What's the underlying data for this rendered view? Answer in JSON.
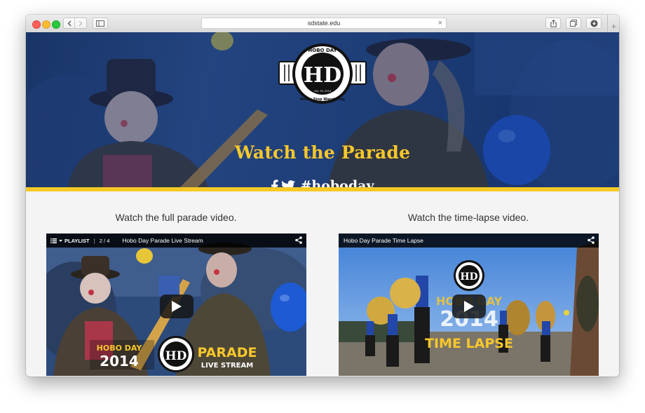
{
  "browser": {
    "url": "sdstate.edu"
  },
  "hero": {
    "logo_text_top": "HOBO DAY",
    "logo_monogram": "HD",
    "logo_date": "Oct. 25, 2014",
    "logo_text_bottom": "Never Stop Wandering",
    "title": "Watch the Parade",
    "hashtag": "#hoboday",
    "accent_color": "#f7c72b"
  },
  "videos": [
    {
      "caption": "Watch the full parade video.",
      "playlist_label": "PLAYLIST",
      "playlist_count": "2 / 4",
      "title": "Hobo Day Parade Live Stream",
      "overlay_left_top": "HOBO DAY",
      "overlay_left_year": "2014",
      "overlay_right_top": "PARADE",
      "overlay_right_bottom": "LIVE STREAM"
    },
    {
      "caption": "Watch the time-lapse video.",
      "title": "Hobo Day Parade Time Lapse",
      "overlay_top": "HOBO DAY",
      "overlay_year": "2014",
      "overlay_bottom": "TIME LAPSE"
    }
  ]
}
